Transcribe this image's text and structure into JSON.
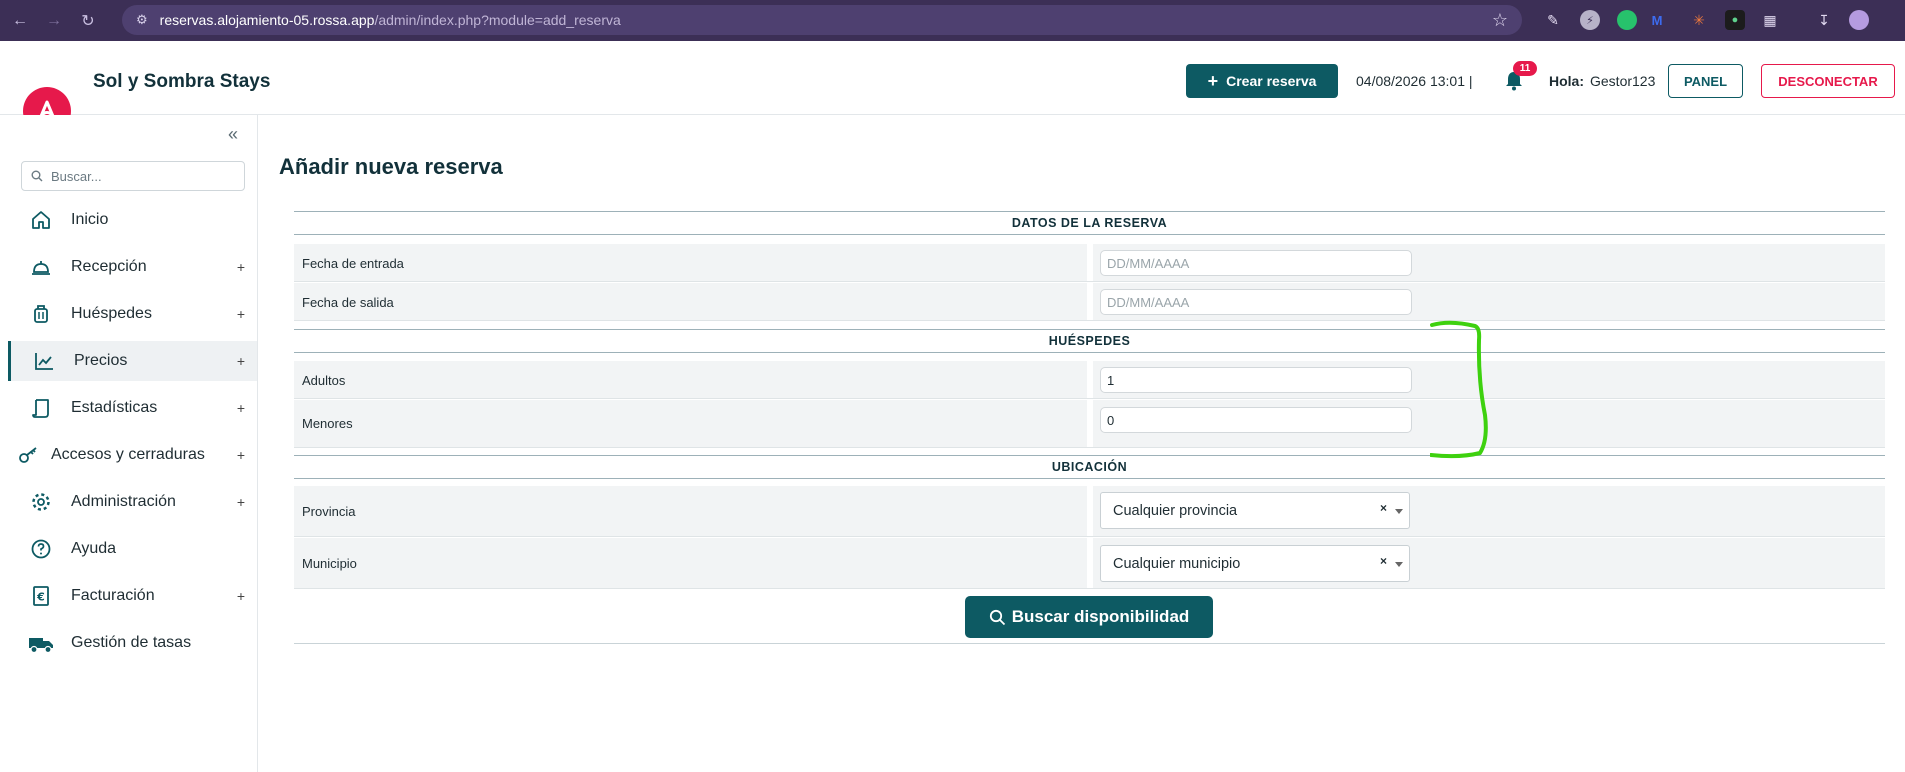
{
  "browser": {
    "url_host": "reservas.alojamiento-05.rossa.app",
    "url_path": "/admin/index.php?module=add_reserva"
  },
  "header": {
    "brand": "Sol y Sombra Stays",
    "create_button": "Crear reserva",
    "datetime": "04/08/2026 13:01 |",
    "notification_count": "11",
    "greeting_label": "Hola:",
    "username": "Gestor123",
    "panel_button": "PANEL",
    "logout_button": "DESCONECTAR"
  },
  "sidebar": {
    "search_placeholder": "Buscar...",
    "items": [
      {
        "label": "Inicio",
        "icon": "home-icon",
        "expandable": false
      },
      {
        "label": "Recepción",
        "icon": "bell-desk-icon",
        "expandable": true
      },
      {
        "label": "Huéspedes",
        "icon": "luggage-icon",
        "expandable": true
      },
      {
        "label": "Precios",
        "icon": "chart-line-icon",
        "expandable": true,
        "active": true
      },
      {
        "label": "Estadísticas",
        "icon": "scroll-icon",
        "expandable": true
      },
      {
        "label": "Accesos y cerraduras",
        "icon": "key-icon",
        "expandable": true
      },
      {
        "label": "Administración",
        "icon": "gear-icon",
        "expandable": true
      },
      {
        "label": "Ayuda",
        "icon": "help-icon",
        "expandable": false
      },
      {
        "label": "Facturación",
        "icon": "invoice-icon",
        "expandable": true
      },
      {
        "label": "Gestión de tasas",
        "icon": "truck-icon",
        "expandable": false
      }
    ],
    "plus_glyph": "+"
  },
  "main": {
    "title": "Añadir nueva reserva",
    "sections": {
      "reserva": "DATOS DE LA RESERVA",
      "huespedes": "HUÉSPEDES",
      "ubicacion": "UBICACIÓN"
    },
    "fields": {
      "fecha_entrada": {
        "label": "Fecha de entrada",
        "placeholder": "DD/MM/AAAA"
      },
      "fecha_salida": {
        "label": "Fecha de salida",
        "placeholder": "DD/MM/AAAA"
      },
      "adultos": {
        "label": "Adultos",
        "value": "1"
      },
      "menores": {
        "label": "Menores",
        "value": "0"
      },
      "provincia": {
        "label": "Provincia",
        "value": "Cualquier provincia"
      },
      "municipio": {
        "label": "Municipio",
        "value": "Cualquier municipio"
      }
    },
    "clear_glyph": "×",
    "search_button": "Buscar disponibilidad"
  },
  "colors": {
    "primary": "#0d5a63",
    "accent": "#e6194b",
    "annotation": "#3ed10f"
  }
}
